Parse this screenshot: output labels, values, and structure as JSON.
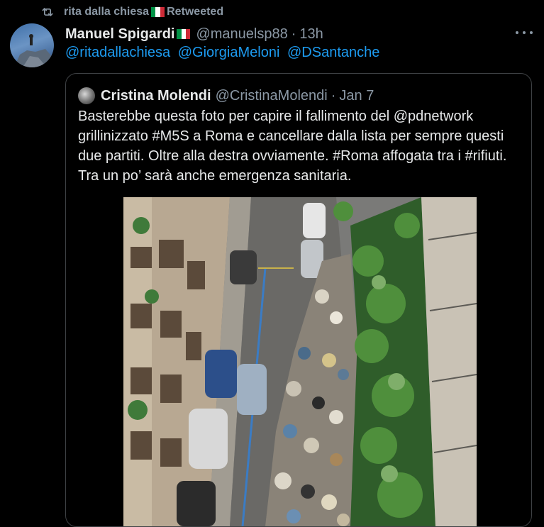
{
  "retweet": {
    "user": "rita dalla chiesa",
    "label": "Retweeted",
    "icon": "retweet-icon"
  },
  "tweet": {
    "author_name": "Manuel Spigardi",
    "handle": "@manuelsp88",
    "separator": "·",
    "time": "13h",
    "mentions": [
      "@ritadallachiesa",
      "@GiorgiaMeloni",
      "@DSantanche"
    ]
  },
  "quoted": {
    "author_name": "Cristina Molendi",
    "handle": "@CristinaMolendi",
    "separator": "·",
    "date": "Jan 7",
    "text": "Basterebbe questa foto per capire il fallimento del @pdnetwork grillinizzato #M5S a Roma e cancellare dalla lista per sempre questi due partiti. Oltre alla destra ovviamente. #Roma affogata tra i #rifiuti. Tra un po’ sarà anche emergenza sanitaria."
  },
  "colors": {
    "background": "#000000",
    "text": "#e7e9ea",
    "muted": "#8b98a5",
    "link": "#1d9bf0",
    "border": "#3e4144"
  },
  "flag_colors": [
    "#009246",
    "#ffffff",
    "#ce2b37"
  ]
}
